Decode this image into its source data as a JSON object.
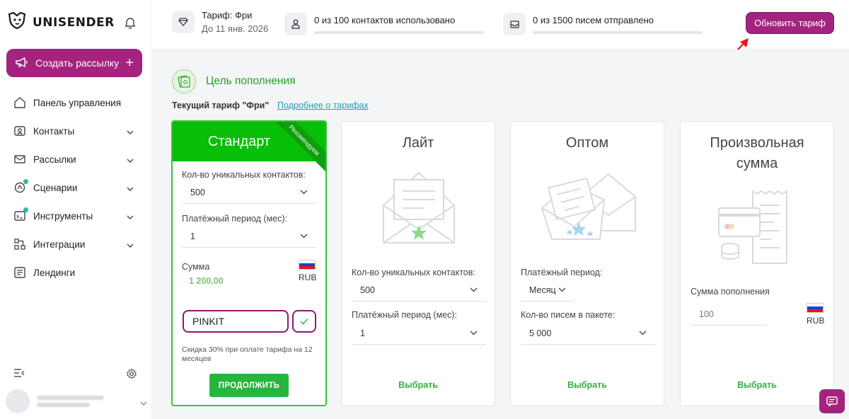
{
  "brand": {
    "name": "UNISENDER"
  },
  "sidebar": {
    "create_label": "Создать рассылку",
    "create_plus": "+",
    "items": [
      {
        "label": "Панель управления",
        "icon": "home-icon",
        "chevron": false,
        "dot": false
      },
      {
        "label": "Контакты",
        "icon": "contacts-icon",
        "chevron": true,
        "dot": false
      },
      {
        "label": "Рассылки",
        "icon": "mail-icon",
        "chevron": true,
        "dot": false
      },
      {
        "label": "Сценарии",
        "icon": "scenario-icon",
        "chevron": true,
        "dot": true
      },
      {
        "label": "Инструменты",
        "icon": "tools-icon",
        "chevron": true,
        "dot": true
      },
      {
        "label": "Интеграции",
        "icon": "integrations-icon",
        "chevron": true,
        "dot": false
      },
      {
        "label": "Лендинги",
        "icon": "landing-icon",
        "chevron": false,
        "dot": false
      }
    ]
  },
  "topbar": {
    "tariff_title": "Тариф: Фри",
    "tariff_until": "До 11 янв. 2026",
    "contacts_usage": "0 из 100 контактов использовано",
    "contacts_progress": 0,
    "letters_usage": "0 из 1500 писем отправлено",
    "letters_progress": 0,
    "upgrade_label": "Обновить тариф"
  },
  "main": {
    "goal_title": "Цель пополнения",
    "current_tariff": "Текущий тариф \"Фри\"",
    "more_link": "Подробнее о тарифах",
    "cards": {
      "standard": {
        "title": "Стандарт",
        "ribbon": "Рекомендуем",
        "contacts_label": "Кол-во уникальных контактов:",
        "contacts_value": "500",
        "period_label": "Платёжный период (мес):",
        "period_value": "1",
        "sum_label": "Сумма",
        "sum_value": "1 200.00",
        "currency": "RUB",
        "promo_value": "PINKIT",
        "discount_text": "Скидка 30% при оплате тарифа на 12 месяцев",
        "continue_label": "ПРОДОЛЖИТЬ"
      },
      "lite": {
        "title": "Лайт",
        "contacts_label": "Кол-во уникальных контактов:",
        "contacts_value": "500",
        "period_label": "Платёжный период (мес):",
        "period_value": "1",
        "choose_label": "Выбрать"
      },
      "bulk": {
        "title": "Оптом",
        "period_label": "Платёжный период:",
        "period_value": "Месяц",
        "letters_label": "Кол-во писем в пакете:",
        "letters_value": "5 000",
        "choose_label": "Выбрать"
      },
      "custom": {
        "title": "Произвольная сумма",
        "sum_label": "Сумма пополнения",
        "sum_placeholder": "100",
        "currency": "RUB",
        "choose_label": "Выбрать"
      }
    }
  },
  "colors": {
    "accent": "#a3237e",
    "green": "#07bf07",
    "link": "#1a9fb0"
  }
}
